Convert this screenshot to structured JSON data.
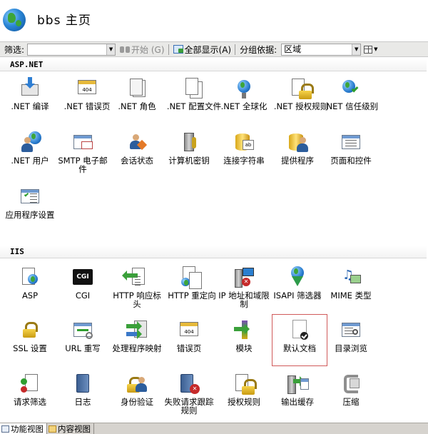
{
  "header": {
    "title": "bbs 主页",
    "icon": "globe-icon"
  },
  "toolbar": {
    "filter_label": "筛选:",
    "filter_value": "",
    "start_label": "开始 (G)",
    "show_all_label": "全部显示(A)",
    "group_by_label": "分组依据:",
    "group_by_value": "区域"
  },
  "sections": {
    "aspnet": {
      "title": "ASP.NET",
      "items": [
        {
          "label": ".NET 编译",
          "icon": "net-compile-icon"
        },
        {
          "label": ".NET 错误页",
          "icon": "net-error-pages-icon"
        },
        {
          "label": ".NET 角色",
          "icon": "net-roles-icon"
        },
        {
          "label": ".NET 配置文件",
          "icon": "net-profile-icon"
        },
        {
          "label": ".NET 全球化",
          "icon": "net-globalization-icon"
        },
        {
          "label": ".NET 授权规则",
          "icon": "net-authorization-icon"
        },
        {
          "label": ".NET 信任级别",
          "icon": "net-trust-levels-icon"
        },
        {
          "label": ".NET 用户",
          "icon": "net-users-icon"
        },
        {
          "label": "SMTP 电子邮件",
          "icon": "smtp-email-icon"
        },
        {
          "label": "会话状态",
          "icon": "session-state-icon"
        },
        {
          "label": "计算机密钥",
          "icon": "machine-key-icon"
        },
        {
          "label": "连接字符串",
          "icon": "connection-strings-icon"
        },
        {
          "label": "提供程序",
          "icon": "providers-icon"
        },
        {
          "label": "页面和控件",
          "icon": "pages-controls-icon"
        },
        {
          "label": "应用程序设置",
          "icon": "app-settings-icon"
        }
      ]
    },
    "iis": {
      "title": "IIS",
      "items": [
        {
          "label": "ASP",
          "icon": "asp-icon"
        },
        {
          "label": "CGI",
          "icon": "cgi-icon"
        },
        {
          "label": "HTTP 响应标头",
          "icon": "http-response-headers-icon"
        },
        {
          "label": "HTTP 重定向",
          "icon": "http-redirect-icon"
        },
        {
          "label": "IP 地址和域限制",
          "icon": "ip-domain-restrictions-icon"
        },
        {
          "label": "ISAPI 筛选器",
          "icon": "isapi-filters-icon"
        },
        {
          "label": "MIME 类型",
          "icon": "mime-types-icon"
        },
        {
          "label": "SSL 设置",
          "icon": "ssl-settings-icon"
        },
        {
          "label": "URL 重写",
          "icon": "url-rewrite-icon"
        },
        {
          "label": "处理程序映射",
          "icon": "handler-mappings-icon"
        },
        {
          "label": "错误页",
          "icon": "error-pages-icon"
        },
        {
          "label": "模块",
          "icon": "modules-icon"
        },
        {
          "label": "默认文档",
          "icon": "default-document-icon"
        },
        {
          "label": "目录浏览",
          "icon": "directory-browsing-icon"
        },
        {
          "label": "请求筛选",
          "icon": "request-filtering-icon"
        },
        {
          "label": "日志",
          "icon": "logging-icon"
        },
        {
          "label": "身份验证",
          "icon": "authentication-icon"
        },
        {
          "label": "失败请求跟踪规则",
          "icon": "failed-request-tracing-icon"
        },
        {
          "label": "授权规则",
          "icon": "authorization-rules-icon"
        },
        {
          "label": "输出缓存",
          "icon": "output-caching-icon"
        },
        {
          "label": "压缩",
          "icon": "compression-icon"
        }
      ]
    }
  },
  "selected_item": "默认文档",
  "bottom_tabs": [
    {
      "label": "功能视图",
      "active": true
    },
    {
      "label": "内容视图",
      "active": false
    }
  ],
  "colors": {
    "toolbar_bg": "#e9e9e7",
    "selection_border": "#d05a5a",
    "accent_blue": "#2b86d6"
  }
}
